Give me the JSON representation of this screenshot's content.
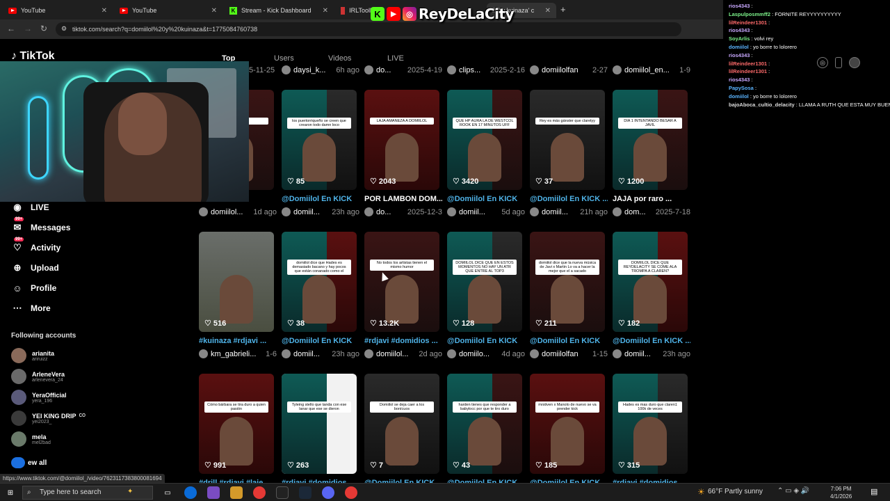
{
  "browser": {
    "tabs": [
      {
        "label": "YouTube",
        "icon": "youtube-icon"
      },
      {
        "label": "YouTube",
        "icon": "youtube-icon"
      },
      {
        "label": "Stream - Kick Dashboard",
        "icon": "kick-icon"
      },
      {
        "label": "IRLTooll",
        "icon": "irl-icon"
      },
      {
        "label": "iiol y kuinaza' c",
        "icon": "tiktok-icon"
      }
    ],
    "url": "tiktok.com/search?q=domiilol%20y%20kuinaza&t=1775084760738"
  },
  "overlay": {
    "brand": "ReyDeLaCity"
  },
  "tiktok": {
    "logo": "TikTok",
    "tabs": [
      "Top",
      "Users",
      "Videos",
      "LIVE"
    ],
    "sidebar": [
      {
        "label": "LIVE",
        "icon": "live-icon",
        "badge": ""
      },
      {
        "label": "Messages",
        "icon": "messages-icon",
        "badge": "99+"
      },
      {
        "label": "Activity",
        "icon": "activity-icon",
        "badge": "99+"
      },
      {
        "label": "Upload",
        "icon": "upload-icon",
        "badge": ""
      },
      {
        "label": "Profile",
        "icon": "profile-icon",
        "badge": ""
      },
      {
        "label": "More",
        "icon": "more-icon",
        "badge": ""
      }
    ],
    "following_title": "Following accounts",
    "following": [
      {
        "name": "arianita",
        "handle": "ariruizz"
      },
      {
        "name": "ArleneVera",
        "handle": "arlenevera_24"
      },
      {
        "name": "YeraOfficial",
        "handle": "yera_196"
      },
      {
        "name": "YEI KING DRIP",
        "handle": "yei2023_",
        "extra": "co"
      },
      {
        "name": "mela",
        "handle": "mel2bad"
      }
    ],
    "view_all": "ew all",
    "top_strip": [
      {
        "user": "daysi_k...",
        "when": "6h ago",
        "date_prefix": "5-11-25"
      },
      {
        "user": "do...",
        "when": "2025-4-19"
      },
      {
        "user": "clips...",
        "when": "2025-2-16"
      },
      {
        "user": "domiilolfan",
        "when": "2-27"
      },
      {
        "user": "domiilol_en...",
        "when": "1-9"
      }
    ],
    "rows": [
      [
        {
          "likes": "",
          "title": "...ICK ...",
          "user": "domiilol...",
          "when": "1d ago",
          "cap": "...tra alli..."
        },
        {
          "likes": "85",
          "title": "@Domiilol En KICK",
          "user": "domiil...",
          "when": "23h ago",
          "cap": "los puertorriqueño se creen que crearon todo damn loco"
        },
        {
          "likes": "2043",
          "title": "POR LAMBON DOM...",
          "user": "do...",
          "when": "2025-12-3",
          "cap": "LAJA AMANEZA A DOMIILOL",
          "plain": true
        },
        {
          "likes": "3420",
          "title": "@Domiilol En KICK",
          "user": "domiil...",
          "when": "5d ago",
          "cap": "QUE HP AURA LA DE WESTCOL ROOK EN 17 MINUTOS UFF"
        },
        {
          "likes": "37",
          "title": "@Domiilol En KICK ...",
          "user": "domiil...",
          "when": "21h ago",
          "cap": "Rey es más gánster que claretyy"
        },
        {
          "likes": "1200",
          "title": "JAJA por raro ...",
          "user": "dom...",
          "when": "2025-7-18",
          "cap": "DIA 1 INTENTANDO BESAR A JAVIL",
          "plain": true
        }
      ],
      [
        {
          "likes": "516",
          "title": "#kuinaza #rdjavi ...",
          "user": "km_gabrieli...",
          "when": "1-6",
          "cap": ""
        },
        {
          "likes": "38",
          "title": "@Domiilol En KICK",
          "user": "domiil...",
          "when": "23h ago",
          "cap": "domiilol dice que Hades es demasiado bacano y hay pocos que están conanado como el"
        },
        {
          "likes": "13.2K",
          "title": "#rdjavi #domidios ...",
          "user": "domiilol...",
          "when": "2d ago",
          "cap": "No todos los artistas tienen el mismo humor"
        },
        {
          "likes": "128",
          "title": "@Domiilol En KICK",
          "user": "domiilo...",
          "when": "4d ago",
          "cap": "DOMIILOL DICE QUE EN ESTOS MOMENTOS NO HAY UN ATR QUE ENTRE AL TOP3"
        },
        {
          "likes": "211",
          "title": "@Domiilol En KICK",
          "user": "domiilolfan",
          "when": "1-15",
          "cap": "domiilol dice que la nueva música de Javi x Martin Lo va a hacer la mejor que el a sacado"
        },
        {
          "likes": "182",
          "title": "@Domiilol En KICK ...",
          "user": "domiil...",
          "when": "23h ago",
          "cap": "DOMIILOL DICE QUE REYDELACITY SE COME ALA TROMPA A CLAREN?"
        }
      ],
      [
        {
          "likes": "991",
          "title": "#drill #rdjavi #laje...",
          "user": "",
          "when": "",
          "cap": "Cómo bárbara se tira duro a quien pasión"
        },
        {
          "likes": "263",
          "title": "#rdjavi #domidios...",
          "user": "",
          "when": "",
          "cap": "Tyleing stello que tanda con ese lanar que ese se dieron"
        },
        {
          "likes": "7",
          "title": "@Domiilol En KICK",
          "user": "",
          "when": "",
          "cap": "Domiilol se deja caer a los bonícuos"
        },
        {
          "likes": "43",
          "title": "@Domiilol En KICK",
          "user": "",
          "when": "",
          "cap": "harden tienes que responder a babylocc por que te tiro duro"
        },
        {
          "likes": "185",
          "title": "@Domiilol En KICK",
          "user": "",
          "when": "",
          "cap": "mrstiven x Manolo de nuevo se va prender kick"
        },
        {
          "likes": "315",
          "title": "#rdjavi #domidios ...",
          "user": "",
          "when": "",
          "cap": "Hades es mas duro que claren1 100k de veces"
        }
      ]
    ],
    "status_url": "https://www.tiktok.com/@domiilol_/video/7623117383800081694"
  },
  "chat": [
    {
      "user": "rios4343",
      "msg": ":",
      "color": "#c9a8ff"
    },
    {
      "user": "Laspulposmmff2",
      "msg": ": FORNITE REYYYYYYYYYY",
      "color": "#7cf28a"
    },
    {
      "user": "lilReindeer1301",
      "msg": ":",
      "color": "#ff6b6b"
    },
    {
      "user": "rios4343",
      "msg": ":",
      "color": "#c9a8ff"
    },
    {
      "user": "SoyArlis",
      "msg": ": volvi rey",
      "color": "#7cf28a"
    },
    {
      "user": "domiilol",
      "msg": ": yo borre to lolorero",
      "color": "#5ab4ff"
    },
    {
      "user": "rios4343",
      "msg": ":",
      "color": "#c9a8ff"
    },
    {
      "user": "lilReindeer1301",
      "msg": ":",
      "color": "#ff6b6b"
    },
    {
      "user": "lilReindeer1301",
      "msg": ":",
      "color": "#ff6b6b"
    },
    {
      "user": "rios4343",
      "msg": ":",
      "color": "#c9a8ff"
    },
    {
      "user": "PapySosa",
      "msg": ":",
      "color": "#5ab4ff"
    },
    {
      "user": "domiilol",
      "msg": ": yo borre to lolorero",
      "color": "#5ab4ff"
    },
    {
      "user": "bajoAboca_cultio_delacity",
      "msg": ": LLAMA A RUTH QUE ESTA MUY BUENA R",
      "color": "#dddddd"
    }
  ],
  "taskbar": {
    "search_placeholder": "Type here to search",
    "weather": "66°F  Partly sunny",
    "time": "7:06 PM",
    "date": "4/1/2026"
  }
}
